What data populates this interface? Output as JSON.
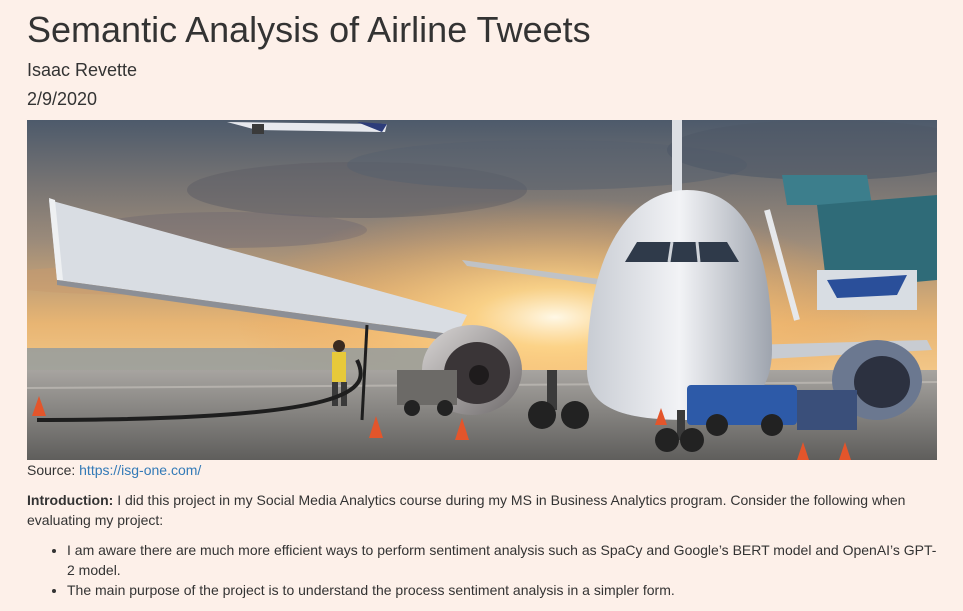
{
  "header": {
    "title": "Semantic Analysis of Airline Tweets",
    "author": "Isaac Revette",
    "date": "2/9/2020"
  },
  "hero_image": {
    "subject": "airplane at airport gate at sunset"
  },
  "source": {
    "label": "Source:",
    "link_text": "https://isg-one.com/",
    "link_color": "#337ab7"
  },
  "intro": {
    "label": "Introduction:",
    "text": "I did this project in my Social Media Analytics course during my MS in Business Analytics program. Consider the following when evaluating my project:"
  },
  "bullets": [
    "I am aware there are much more efficient ways to perform sentiment analysis such as SpaCy and Google’s BERT model and OpenAI’s GPT-2 model.",
    "The main purpose of the project is to understand the process sentiment analysis in a simpler form."
  ],
  "colors": {
    "background": "#fdf0e9",
    "text": "#333333"
  }
}
